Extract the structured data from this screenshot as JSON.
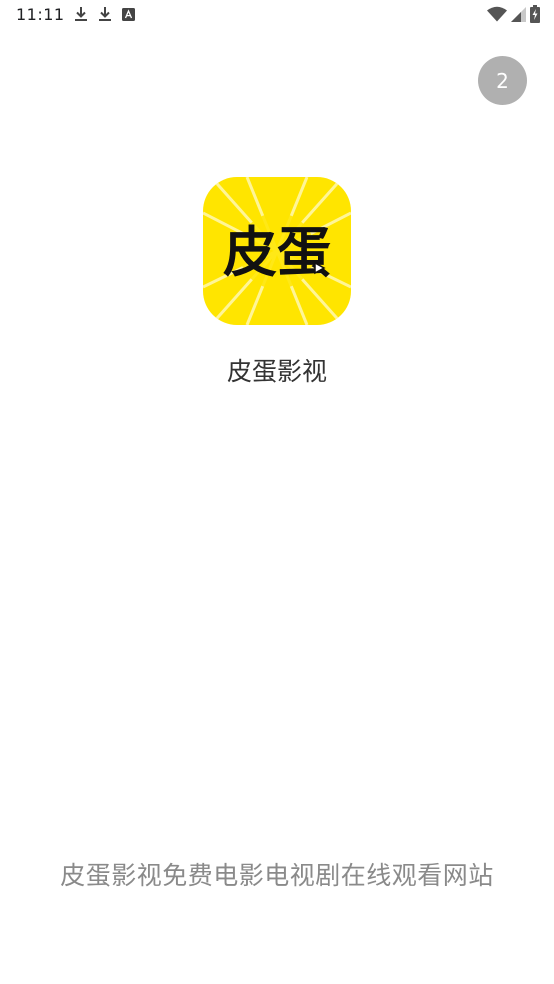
{
  "status_bar": {
    "time": "11:11",
    "icons_left": [
      "download-icon",
      "download-icon",
      "app-notification-icon"
    ],
    "icons_right": [
      "wifi-icon",
      "cell-signal-icon",
      "battery-charging-icon"
    ]
  },
  "splash": {
    "countdown": "2",
    "logo_text": "皮蛋",
    "app_name": "皮蛋影视",
    "tagline": "皮蛋影视免费电影电视剧在线观看网站"
  },
  "colors": {
    "logo_background": "#FFE500",
    "countdown_background": "#B0B0B0",
    "tagline_text": "#8A8A8A",
    "app_name_text": "#333333"
  }
}
